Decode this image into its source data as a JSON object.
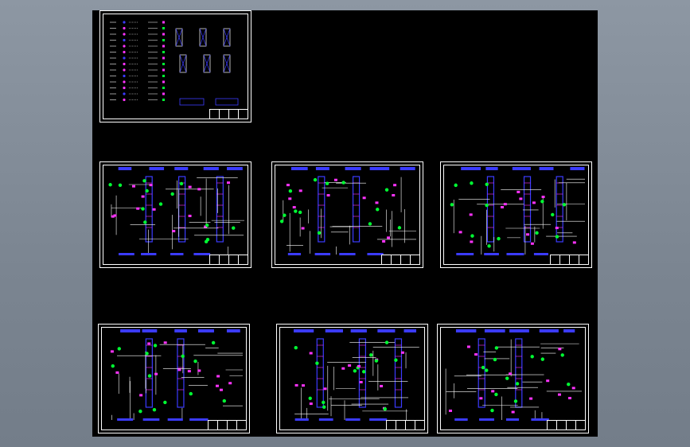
{
  "colors": {
    "background": "#000000",
    "frame": "#ffffff",
    "equipment": "#3b3bff",
    "instrument": "#00ff33",
    "valve": "#ff33ff",
    "line": "#ffffff",
    "accent": "#00ccff"
  },
  "sheets": [
    {
      "id": "legend",
      "kind": "legend"
    },
    {
      "id": "pid-1",
      "kind": "pid",
      "seed": 3
    },
    {
      "id": "pid-2",
      "kind": "pid",
      "seed": 7
    },
    {
      "id": "pid-3",
      "kind": "pid",
      "seed": 11
    },
    {
      "id": "pid-4",
      "kind": "pid",
      "seed": 17
    },
    {
      "id": "pid-5",
      "kind": "pid",
      "seed": 23
    },
    {
      "id": "pid-6",
      "kind": "pid",
      "seed": 29
    }
  ]
}
